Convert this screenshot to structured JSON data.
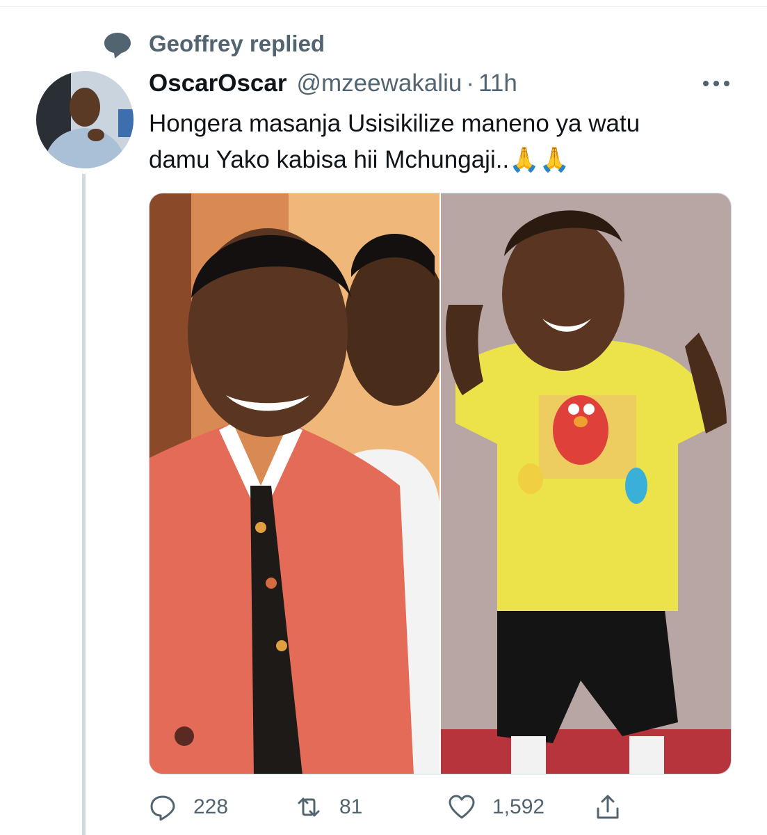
{
  "social_context": {
    "text": "Geoffrey replied",
    "icon": "speech-bubble-icon"
  },
  "tweet": {
    "display_name": "OscarOscar",
    "handle": "@mzeewakaliu",
    "separator": "·",
    "time": "11h",
    "text_line1": "Hongera masanja Usisikilize maneno ya watu",
    "text_line2": "damu Yako kabisa hii Mchungaji..🙏🙏"
  },
  "actions": {
    "reply_count": "228",
    "retweet_count": "81",
    "like_count": "1,592"
  },
  "colors": {
    "secondary_text": "#536471",
    "primary_text": "#0f1419",
    "thread_line": "#cfd9de"
  }
}
